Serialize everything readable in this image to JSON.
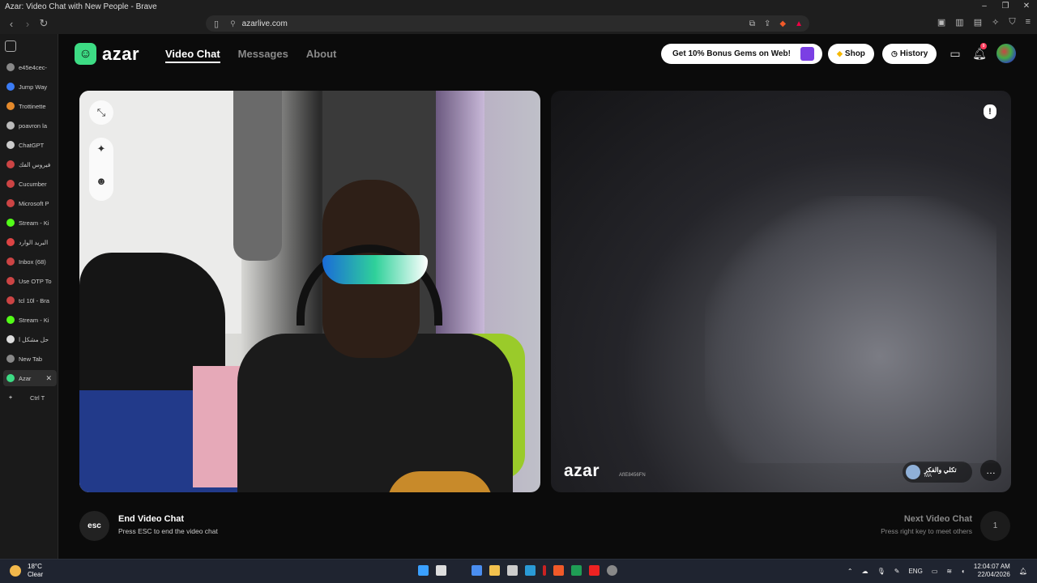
{
  "window": {
    "title": "Azar: Video Chat with New People - Brave",
    "controls": [
      "–",
      "❐",
      "✕"
    ]
  },
  "toolbar": {
    "url": "azarlive.com"
  },
  "sidebar": {
    "tabs": [
      {
        "label": "e45e4cec-",
        "color": "#888"
      },
      {
        "label": "Jump Way",
        "color": "#3b7cf5"
      },
      {
        "label": "Trottinette",
        "color": "#e58a2b"
      },
      {
        "label": "poavron la",
        "color": "#bbb"
      },
      {
        "label": "ChatGPT",
        "color": "#ccc"
      },
      {
        "label": "فيروس الفك",
        "color": "#c44"
      },
      {
        "label": "Cucumber",
        "color": "#c44"
      },
      {
        "label": "Microsoft P",
        "color": "#c44"
      },
      {
        "label": "Stream - Ki",
        "color": "#53fc18"
      },
      {
        "label": "البريد الوارد",
        "color": "#d44"
      },
      {
        "label": "Inbox (68)",
        "color": "#c44"
      },
      {
        "label": "Use OTP To",
        "color": "#c44"
      },
      {
        "label": "tcl 10l - Bra",
        "color": "#c44"
      },
      {
        "label": "Stream - Ki",
        "color": "#53fc18"
      },
      {
        "label": "حل مشكل ا",
        "color": "#ddd"
      },
      {
        "label": "New Tab",
        "color": "#888"
      },
      {
        "label": "Azar",
        "color": "#3ddc84"
      }
    ],
    "new_tab_label": "Ctrl  T"
  },
  "header": {
    "logo_text": "azar",
    "nav": [
      {
        "label": "Video Chat",
        "active": true
      },
      {
        "label": "Messages",
        "active": false
      },
      {
        "label": "About",
        "active": false
      }
    ],
    "promo_label": "Get 10% Bonus Gems on Web!",
    "shop_label": "Shop",
    "history_label": "History",
    "notification_count": "9"
  },
  "remote": {
    "watermark": "azar",
    "user_id": "AfIE8456FN",
    "username": "تكلي والفكر",
    "country": "MA"
  },
  "footer": {
    "esc_label": "esc",
    "end_title": "End Video Chat",
    "end_sub": "Press ESC to end the video chat",
    "next_title": "Next Video Chat",
    "next_sub": "Press right key to meet others",
    "next_key": "1"
  },
  "taskbar": {
    "temp": "18°C",
    "weather": "Clear",
    "lang": "ENG",
    "time": "12:04:07 AM",
    "date": "22/04/2026"
  }
}
